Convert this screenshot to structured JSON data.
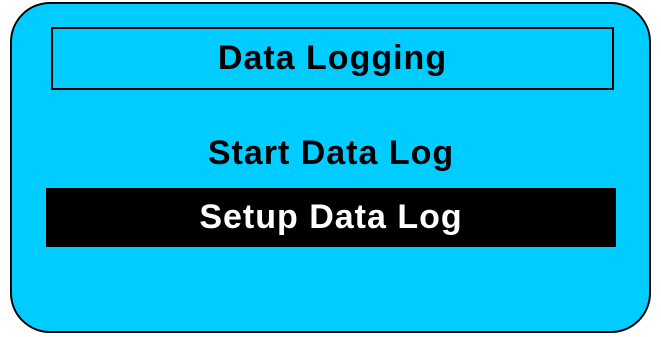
{
  "screen": {
    "title": "Data Logging",
    "menu_items": [
      {
        "label": "Start Data Log",
        "selected": false
      },
      {
        "label": "Setup Data Log",
        "selected": true
      }
    ]
  },
  "colors": {
    "background": "#00ccff",
    "highlight_bg": "#000000",
    "highlight_text": "#ffffff",
    "text": "#000000"
  }
}
